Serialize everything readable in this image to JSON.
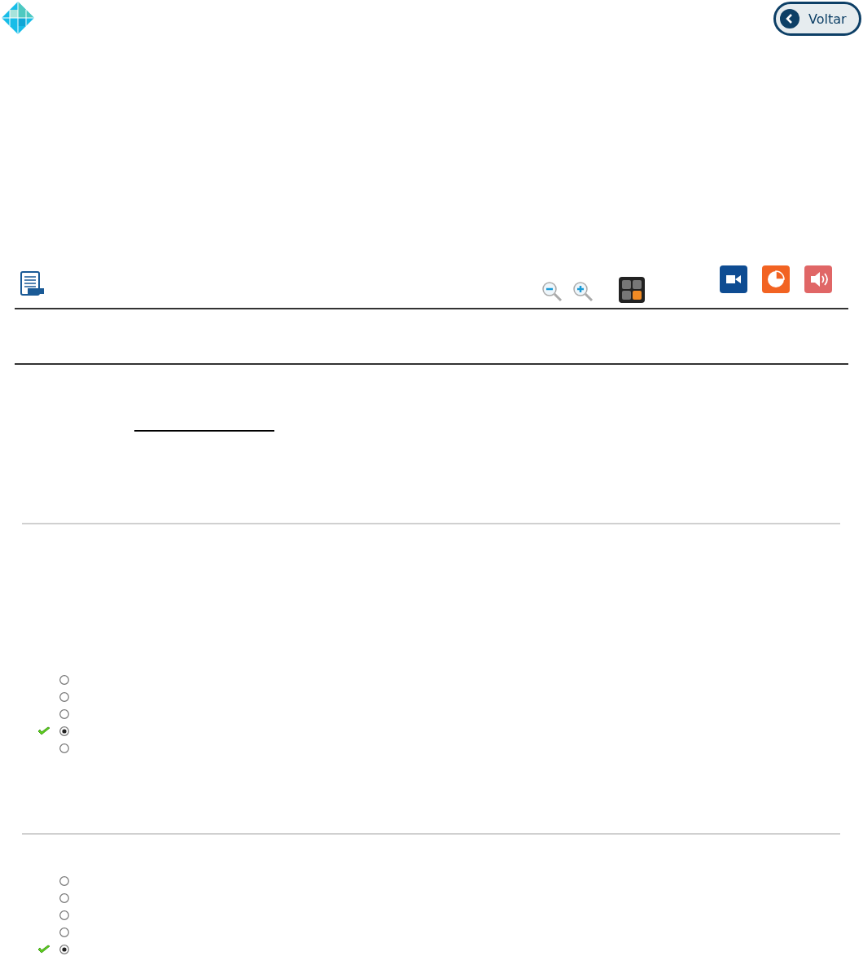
{
  "back_button": {
    "label": "Voltar"
  },
  "questions": [
    {
      "options": [
        {
          "selected": false,
          "correct": false
        },
        {
          "selected": false,
          "correct": false
        },
        {
          "selected": false,
          "correct": false
        },
        {
          "selected": true,
          "correct": true
        },
        {
          "selected": false,
          "correct": false
        }
      ]
    },
    {
      "options": [
        {
          "selected": false,
          "correct": false
        },
        {
          "selected": false,
          "correct": false
        },
        {
          "selected": false,
          "correct": false
        },
        {
          "selected": false,
          "correct": false
        },
        {
          "selected": true,
          "correct": true
        }
      ]
    }
  ]
}
